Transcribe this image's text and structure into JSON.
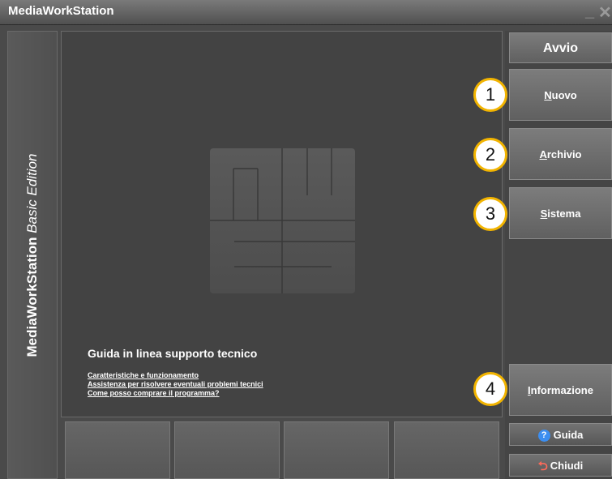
{
  "window": {
    "title": "MediaWorkStation",
    "minimize": "_",
    "close": "✕"
  },
  "sidebar": {
    "brand": "MediaWorkStation",
    "edition": "Basic Edition"
  },
  "main": {
    "help_title": "Guida in linea supporto tecnico",
    "links": [
      "Caratteristiche e funzionamento",
      "Assistenza per risolvere eventuali problemi tecnici",
      "Come posso comprare il programma?"
    ]
  },
  "menu": {
    "header": "Avvio",
    "nuovo": {
      "first": "N",
      "rest": "uovo",
      "badge": "1"
    },
    "archivio": {
      "first": "A",
      "rest": "rchivio",
      "badge": "2"
    },
    "sistema": {
      "first": "S",
      "rest": "istema",
      "badge": "3"
    },
    "informazione": {
      "first": "I",
      "rest": "nformazione",
      "badge": "4"
    }
  },
  "footer": {
    "guida": {
      "first": "G",
      "rest": "uida",
      "icon": "help-icon"
    },
    "chiudi": {
      "pre": "C",
      "ul": "h",
      "post": "iudi",
      "icon": "exit-arrow-icon"
    }
  },
  "colors": {
    "badge_border": "#f2b400",
    "help_icon": "#3c8ef0",
    "exit_icon": "#ff6a5a"
  }
}
